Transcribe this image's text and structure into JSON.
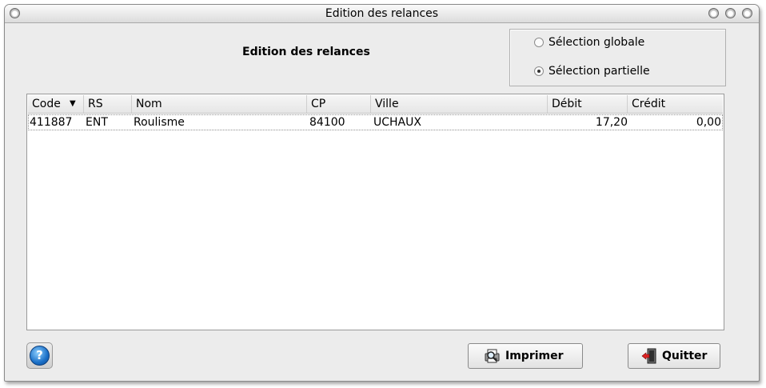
{
  "window": {
    "title": "Edition des relances"
  },
  "heading": "Edition des relances",
  "selection": {
    "options": [
      {
        "label": "Sélection globale",
        "checked": false
      },
      {
        "label": "Sélection partielle",
        "checked": true
      }
    ]
  },
  "table": {
    "columns": [
      "Code",
      "RS",
      "Nom",
      "CP",
      "Ville",
      "Débit",
      "Crédit"
    ],
    "rows": [
      {
        "code": "411887",
        "rs": "ENT",
        "nom": "Roulisme",
        "cp": "84100",
        "ville": "UCHAUX",
        "debit": "17,20",
        "credit": "0,00"
      }
    ]
  },
  "buttons": {
    "help_glyph": "?",
    "print": {
      "label": "Imprimer",
      "icon": "printer-magnifier-icon"
    },
    "quit": {
      "label": "Quitter",
      "icon": "exit-door-icon"
    }
  }
}
